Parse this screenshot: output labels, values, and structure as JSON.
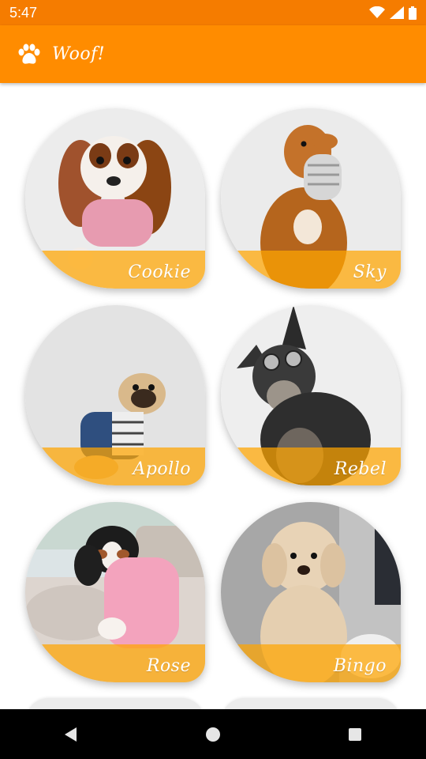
{
  "status_bar": {
    "time": "5:47"
  },
  "app_bar": {
    "title": "Woof!",
    "icon": "paw-icon"
  },
  "dogs": [
    {
      "name": "Cookie"
    },
    {
      "name": "Sky"
    },
    {
      "name": "Apollo"
    },
    {
      "name": "Rebel"
    },
    {
      "name": "Rose"
    },
    {
      "name": "Bingo"
    }
  ],
  "colors": {
    "status_bar": "#f57c00",
    "app_bar": "#ff8c00",
    "caption_overlay": "#ffa500"
  },
  "nav": {
    "back": "back-icon",
    "home": "home-icon",
    "recents": "recents-icon"
  }
}
